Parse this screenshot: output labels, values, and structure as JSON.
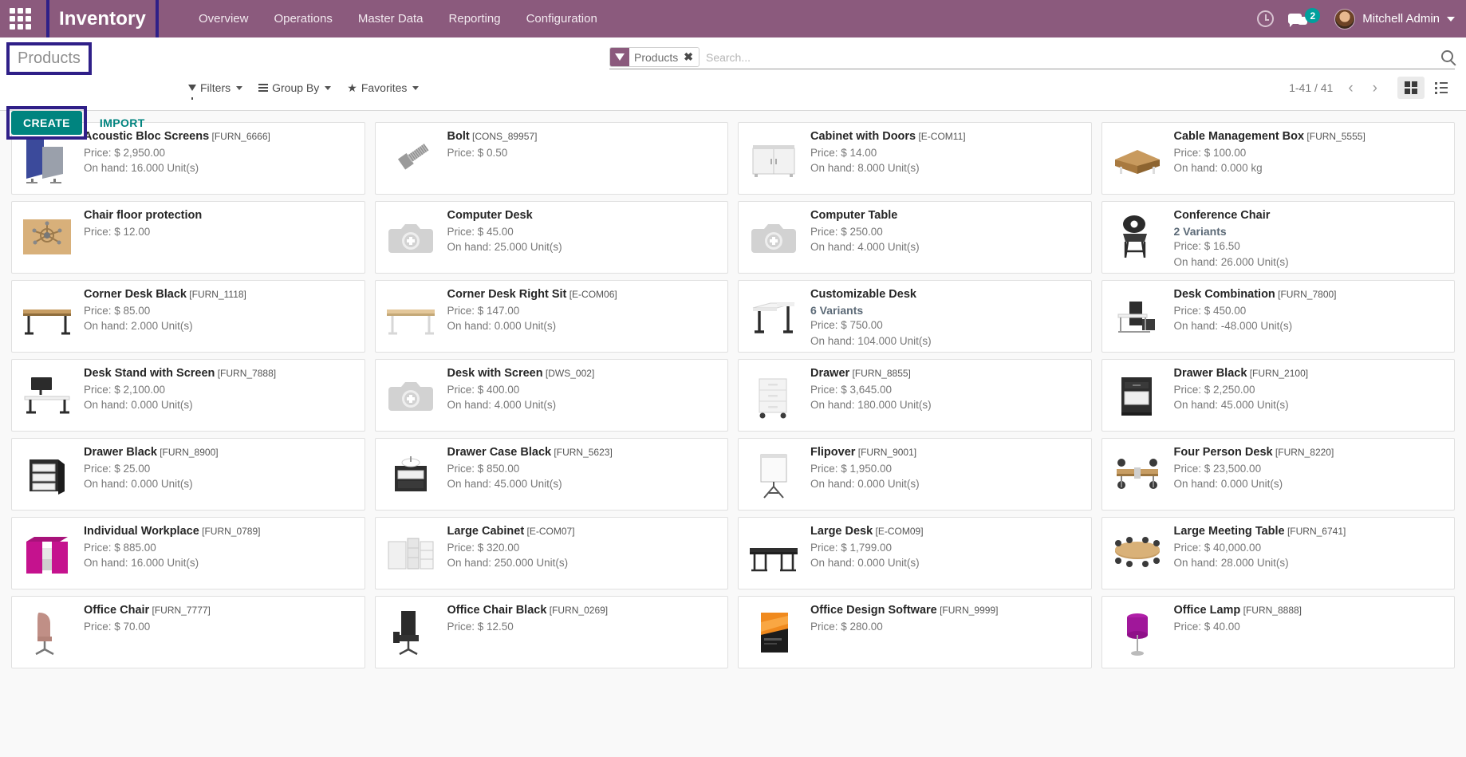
{
  "navbar": {
    "apps_icon": "apps-grid-icon",
    "brand": "Inventory",
    "menu": [
      {
        "label": "Overview"
      },
      {
        "label": "Operations"
      },
      {
        "label": "Master Data"
      },
      {
        "label": "Reporting"
      },
      {
        "label": "Configuration"
      }
    ],
    "activities_icon": "clock-icon",
    "messages_icon": "chat-bubble-icon",
    "messages_count": "2",
    "user_name": "Mitchell Admin",
    "bg_color": "#8b5a7d",
    "highlight_color": "#2f1f88"
  },
  "control": {
    "breadcrumb": "Products",
    "create_label": "CREATE",
    "import_label": "IMPORT",
    "create_color": "#00847f",
    "search": {
      "facet_label": "Products",
      "facet_remove": "✖",
      "placeholder": "Search...",
      "value": "",
      "search_icon": "magnifier-icon"
    },
    "tools": [
      {
        "label": "Filters",
        "icon": "funnel-icon"
      },
      {
        "label": "Group By",
        "icon": "bars-icon"
      },
      {
        "label": "Favorites",
        "icon": "star-icon"
      }
    ],
    "pager": {
      "count": "1-41 / 41",
      "prev": "‹",
      "next": "›"
    },
    "views": [
      {
        "name": "kanban",
        "active": true
      },
      {
        "name": "list",
        "active": false
      }
    ]
  },
  "labels": {
    "price_prefix": "Price: $ ",
    "onhand_prefix": "On hand: ",
    "unit_suffix": " Unit(s)"
  },
  "products": [
    {
      "name": "Acoustic Bloc Screens",
      "code": "[FURN_6666]",
      "variants": "",
      "price": "Price: $ 2,950.00",
      "onhand": "On hand: 16.000 Unit(s)",
      "image": "screens"
    },
    {
      "name": "Bolt",
      "code": "[CONS_89957]",
      "variants": "",
      "price": "Price: $ 0.50",
      "onhand": "",
      "image": "bolt"
    },
    {
      "name": "Cabinet with Doors",
      "code": "[E-COM11]",
      "variants": "",
      "price": "Price: $ 14.00",
      "onhand": "On hand: 8.000 Unit(s)",
      "image": "cabinet"
    },
    {
      "name": "Cable Management Box",
      "code": "[FURN_5555]",
      "variants": "",
      "price": "Price: $ 100.00",
      "onhand": "On hand: 0.000 kg",
      "image": "cablebox"
    },
    {
      "name": "Chair floor protection",
      "code": "",
      "variants": "",
      "price": "Price: $ 12.00",
      "onhand": "",
      "image": "floormat"
    },
    {
      "name": "Computer Desk",
      "code": "",
      "variants": "",
      "price": "Price: $ 45.00",
      "onhand": "On hand: 25.000 Unit(s)",
      "image": "placeholder"
    },
    {
      "name": "Computer Table",
      "code": "",
      "variants": "",
      "price": "Price: $ 250.00",
      "onhand": "On hand: 4.000 Unit(s)",
      "image": "placeholder"
    },
    {
      "name": "Conference Chair",
      "code": "",
      "variants": "2 Variants",
      "price": "Price: $ 16.50",
      "onhand": "On hand: 26.000 Unit(s)",
      "image": "chair-black"
    },
    {
      "name": "Corner Desk Black",
      "code": "[FURN_1118]",
      "variants": "",
      "price": "Price: $ 85.00",
      "onhand": "On hand: 2.000 Unit(s)",
      "image": "desk-wood"
    },
    {
      "name": "Corner Desk Right Sit",
      "code": "[E-COM06]",
      "variants": "",
      "price": "Price: $ 147.00",
      "onhand": "On hand: 0.000 Unit(s)",
      "image": "desk-light"
    },
    {
      "name": "Customizable Desk",
      "code": "",
      "variants": "6 Variants",
      "price": "Price: $ 750.00",
      "onhand": "On hand: 104.000 Unit(s)",
      "image": "desk-white"
    },
    {
      "name": "Desk Combination",
      "code": "[FURN_7800]",
      "variants": "",
      "price": "Price: $ 450.00",
      "onhand": "On hand: -48.000 Unit(s)",
      "image": "desk-combo"
    },
    {
      "name": "Desk Stand with Screen",
      "code": "[FURN_7888]",
      "variants": "",
      "price": "Price: $ 2,100.00",
      "onhand": "On hand: 0.000 Unit(s)",
      "image": "deskstand"
    },
    {
      "name": "Desk with Screen",
      "code": "[DWS_002]",
      "variants": "",
      "price": "Price: $ 400.00",
      "onhand": "On hand: 4.000 Unit(s)",
      "image": "placeholder"
    },
    {
      "name": "Drawer",
      "code": "[FURN_8855]",
      "variants": "",
      "price": "Price: $ 3,645.00",
      "onhand": "On hand: 180.000 Unit(s)",
      "image": "drawer-white"
    },
    {
      "name": "Drawer Black",
      "code": "[FURN_2100]",
      "variants": "",
      "price": "Price: $ 2,250.00",
      "onhand": "On hand: 45.000 Unit(s)",
      "image": "drawer-black"
    },
    {
      "name": "Drawer Black",
      "code": "[FURN_8900]",
      "variants": "",
      "price": "Price: $ 25.00",
      "onhand": "On hand: 0.000 Unit(s)",
      "image": "drawer-black2"
    },
    {
      "name": "Drawer Case Black",
      "code": "[FURN_5623]",
      "variants": "",
      "price": "Price: $ 850.00",
      "onhand": "On hand: 45.000 Unit(s)",
      "image": "drawercase"
    },
    {
      "name": "Flipover",
      "code": "[FURN_9001]",
      "variants": "",
      "price": "Price: $ 1,950.00",
      "onhand": "On hand: 0.000 Unit(s)",
      "image": "flipover"
    },
    {
      "name": "Four Person Desk",
      "code": "[FURN_8220]",
      "variants": "",
      "price": "Price: $ 23,500.00",
      "onhand": "On hand: 0.000 Unit(s)",
      "image": "fourdesk"
    },
    {
      "name": "Individual Workplace",
      "code": "[FURN_0789]",
      "variants": "",
      "price": "Price: $ 885.00",
      "onhand": "On hand: 16.000 Unit(s)",
      "image": "workplace"
    },
    {
      "name": "Large Cabinet",
      "code": "[E-COM07]",
      "variants": "",
      "price": "Price: $ 320.00",
      "onhand": "On hand: 250.000 Unit(s)",
      "image": "largecab"
    },
    {
      "name": "Large Desk",
      "code": "[E-COM09]",
      "variants": "",
      "price": "Price: $ 1,799.00",
      "onhand": "On hand: 0.000 Unit(s)",
      "image": "largedesk"
    },
    {
      "name": "Large Meeting Table",
      "code": "[FURN_6741]",
      "variants": "",
      "price": "Price: $ 40,000.00",
      "onhand": "On hand: 28.000 Unit(s)",
      "image": "meeting"
    },
    {
      "name": "Office Chair",
      "code": "[FURN_7777]",
      "variants": "",
      "price": "Price: $ 70.00",
      "onhand": "",
      "image": "officechair"
    },
    {
      "name": "Office Chair Black",
      "code": "[FURN_0269]",
      "variants": "",
      "price": "Price: $ 12.50",
      "onhand": "",
      "image": "officechair-black"
    },
    {
      "name": "Office Design Software",
      "code": "[FURN_9999]",
      "variants": "",
      "price": "Price: $ 280.00",
      "onhand": "",
      "image": "software"
    },
    {
      "name": "Office Lamp",
      "code": "[FURN_8888]",
      "variants": "",
      "price": "Price: $ 40.00",
      "onhand": "",
      "image": "lamp"
    }
  ]
}
